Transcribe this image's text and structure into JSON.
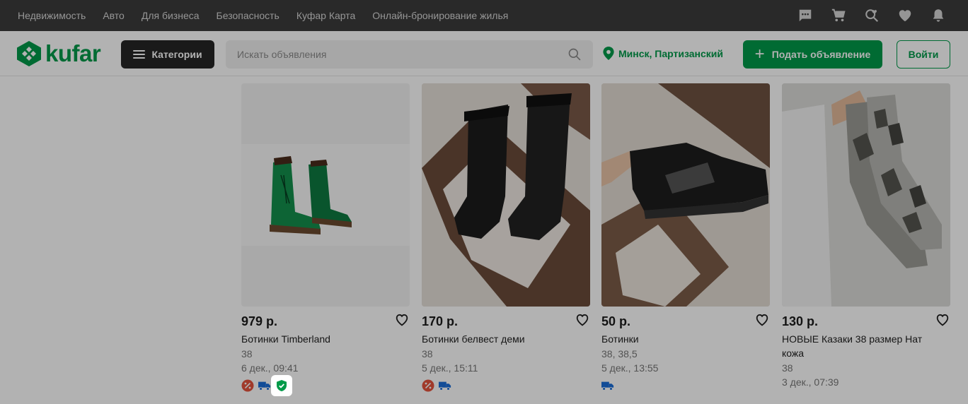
{
  "topbar": {
    "links": [
      "Недвижимость",
      "Авто",
      "Для бизнеса",
      "Безопасность",
      "Куфар Карта",
      "Онлайн-бронирование жилья"
    ],
    "icons": [
      "chat-icon",
      "cart-icon",
      "search-heart-icon",
      "heart-icon",
      "bell-icon"
    ]
  },
  "header": {
    "logo_text": "kufar",
    "categories_label": "Категории",
    "search_placeholder": "Искать объявления",
    "location": "Минск, Партизанский",
    "post_label": "Подать объявление",
    "login_label": "Войти"
  },
  "colors": {
    "brand": "#009a49",
    "topbar": "#3b3b3b",
    "discount": "#e5533d",
    "delivery": "#1a6ed8"
  },
  "listings": [
    {
      "price": "979 р.",
      "title": "Ботинки Timberland",
      "size": "38",
      "date": "6 дек., 09:41",
      "badges": [
        "discount-icon",
        "delivery-icon",
        "shield-check-icon"
      ]
    },
    {
      "price": "170 р.",
      "title": "Ботинки белвест деми",
      "size": "38",
      "date": "5 дек., 15:11",
      "badges": [
        "discount-icon",
        "delivery-icon"
      ]
    },
    {
      "price": "50 р.",
      "title": "Ботинки",
      "size": "38, 38,5",
      "date": "5 дек., 13:55",
      "badges": [
        "delivery-icon"
      ]
    },
    {
      "price": "130 р.",
      "title": "НОВЫЕ Казаки 38 размер Нат кожа",
      "size": "38",
      "date": "3 дек., 07:39",
      "badges": []
    }
  ]
}
